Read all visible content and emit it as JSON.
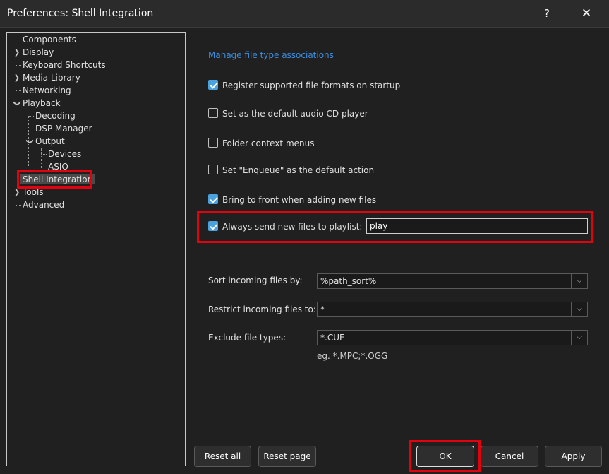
{
  "window": {
    "title": "Preferences: Shell Integration",
    "help_label": "?",
    "close_label": "✕"
  },
  "tree": {
    "items": [
      {
        "label": "Components"
      },
      {
        "label": "Display"
      },
      {
        "label": "Keyboard Shortcuts"
      },
      {
        "label": "Media Library"
      },
      {
        "label": "Networking"
      },
      {
        "label": "Playback"
      },
      {
        "label": "Decoding"
      },
      {
        "label": "DSP Manager"
      },
      {
        "label": "Output"
      },
      {
        "label": "Devices"
      },
      {
        "label": "ASIO"
      },
      {
        "label": "Shell Integration"
      },
      {
        "label": "Tools"
      },
      {
        "label": "Advanced"
      }
    ]
  },
  "main": {
    "link_label": "Manage file type associations",
    "options": [
      {
        "label": "Register supported file formats on startup",
        "checked": true
      },
      {
        "label": "Set as the default audio CD player",
        "checked": false
      },
      {
        "label": "Folder context menus",
        "checked": false
      },
      {
        "label": "Set \"Enqueue\" as the default action",
        "checked": false
      },
      {
        "label": "Bring to front when adding new files",
        "checked": true
      },
      {
        "label": "Always send new files to playlist:",
        "checked": true
      }
    ],
    "playlist_value": "play",
    "sort_label": "Sort incoming files by:",
    "sort_value": "%path_sort%",
    "restrict_label": "Restrict incoming files to:",
    "restrict_value": "*",
    "exclude_label": "Exclude file types:",
    "exclude_value": "*.CUE",
    "exclude_hint": "eg. *.MPC;*.OGG"
  },
  "buttons": {
    "reset_all": "Reset all",
    "reset_page": "Reset page",
    "ok": "OK",
    "cancel": "Cancel",
    "apply": "Apply"
  },
  "colors": {
    "accent": "#4aa3df",
    "highlight": "#e3000f",
    "link": "#3c8fe0"
  }
}
